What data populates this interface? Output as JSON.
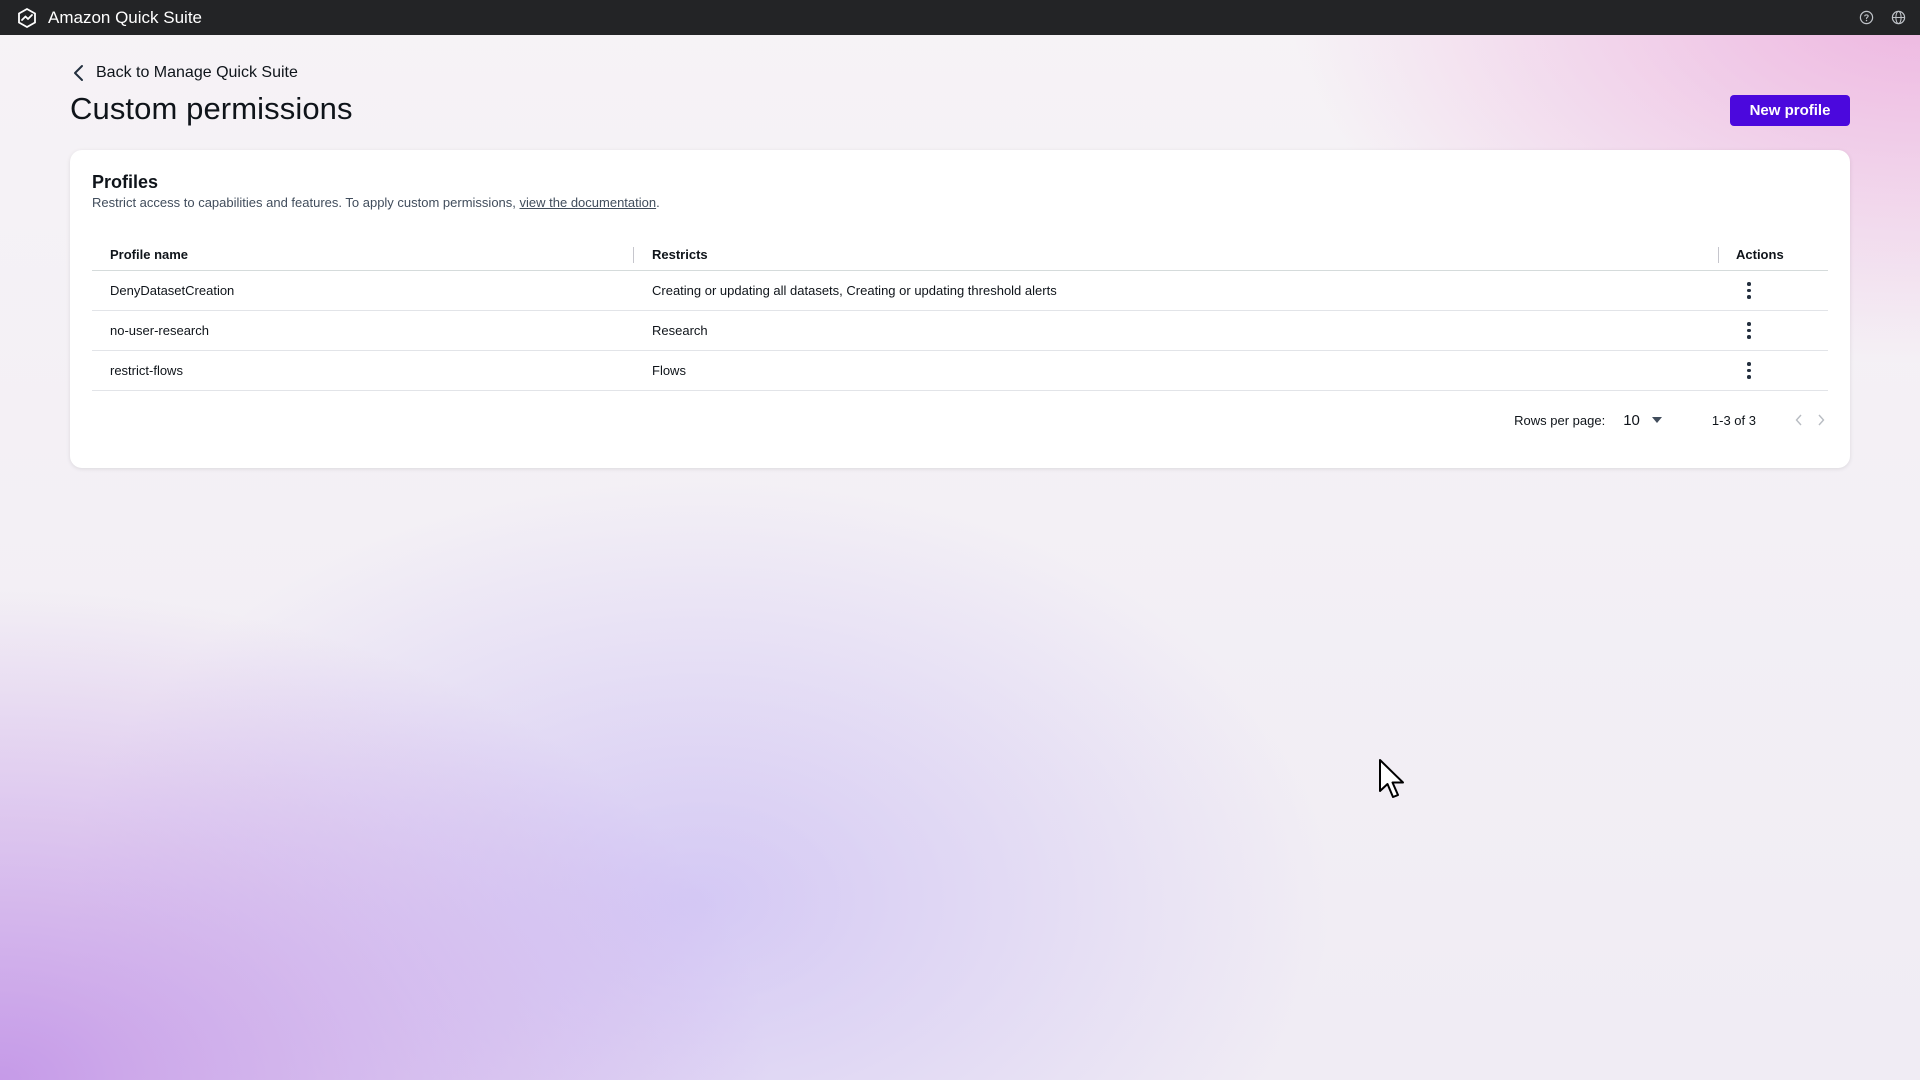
{
  "app": {
    "name": "Amazon Quick Suite"
  },
  "header_icons": [
    "help-icon",
    "globe-icon"
  ],
  "nav": {
    "back_label": "Back to Manage Quick Suite"
  },
  "page": {
    "title": "Custom permissions",
    "new_profile_label": "New profile"
  },
  "profiles": {
    "title": "Profiles",
    "description_prefix": "Restrict access to capabilities and features. To apply custom permissions, ",
    "description_link": "view the documentation",
    "description_suffix": ".",
    "columns": {
      "name": "Profile name",
      "restricts": "Restricts",
      "actions": "Actions"
    },
    "rows": [
      {
        "name": "DenyDatasetCreation",
        "restricts": "Creating or updating all datasets, Creating or updating threshold alerts"
      },
      {
        "name": "no-user-research",
        "restricts": "Research"
      },
      {
        "name": "restrict-flows",
        "restricts": "Flows"
      }
    ],
    "pagination": {
      "rows_per_page_label": "Rows per page:",
      "rows_per_page_value": "10",
      "range": "1-3 of 3"
    }
  },
  "colors": {
    "topbar": "#232426",
    "primary_button": "#4b08dd",
    "text": "#0f141a"
  }
}
